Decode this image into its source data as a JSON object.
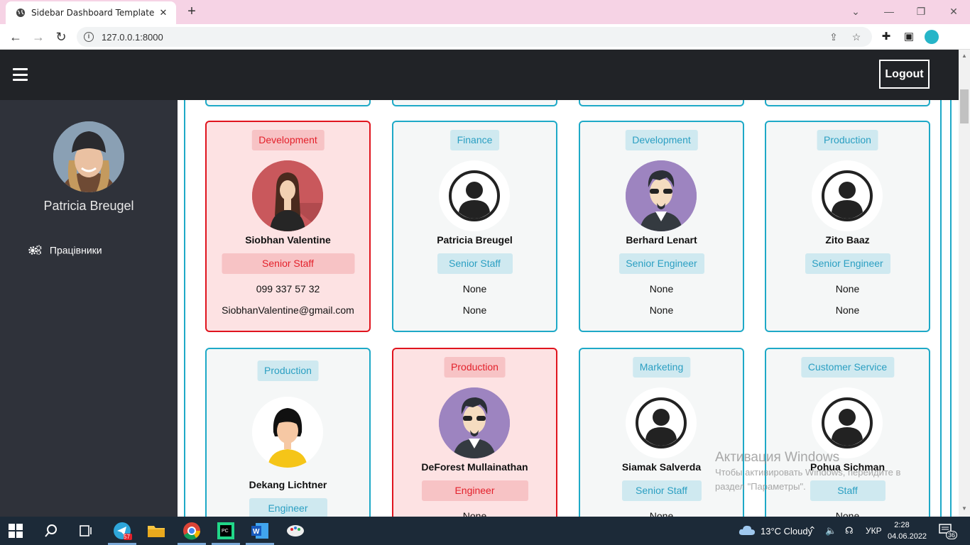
{
  "browser": {
    "tab_title": "Sidebar Dashboard Template",
    "url": "127.0.0.1:8000"
  },
  "header": {
    "logout_label": "Logout"
  },
  "sidebar": {
    "user_name": "Patricia Breugel",
    "items": [
      {
        "label": "Працівники",
        "icon": "gears-icon"
      }
    ]
  },
  "cards": [
    {
      "dept": "Development",
      "name": "Siobhan Valentine",
      "position": "Senior Staff",
      "phone": "099 337 57 32",
      "email": "SiobhanValentine@gmail.com",
      "avatar": "woman-dark-hair",
      "highlight": true
    },
    {
      "dept": "Finance",
      "name": "Patricia Breugel",
      "position": "Senior Staff",
      "phone": "None",
      "email": "None",
      "avatar": "default-user",
      "highlight": false
    },
    {
      "dept": "Development",
      "name": "Berhard Lenart",
      "position": "Senior Engineer",
      "phone": "None",
      "email": "None",
      "avatar": "man-sunglasses",
      "highlight": false
    },
    {
      "dept": "Production",
      "name": "Zito Baaz",
      "position": "Senior Engineer",
      "phone": "None",
      "email": "None",
      "avatar": "default-user",
      "highlight": false
    },
    {
      "dept": "Production",
      "name": "Dekang Lichtner",
      "position": "Engineer",
      "phone": "",
      "email": "",
      "avatar": "woman-yellow",
      "highlight": false
    },
    {
      "dept": "Production",
      "name": "DeForest Mullainathan",
      "position": "Engineer",
      "phone": "None",
      "email": "",
      "avatar": "man-sunglasses",
      "highlight": true
    },
    {
      "dept": "Marketing",
      "name": "Siamak Salverda",
      "position": "Senior Staff",
      "phone": "None",
      "email": "",
      "avatar": "default-user",
      "highlight": false
    },
    {
      "dept": "Customer Service",
      "name": "Pohua Sichman",
      "position": "Staff",
      "phone": "None",
      "email": "",
      "avatar": "default-user",
      "highlight": false
    }
  ],
  "watermark": {
    "title": "Активация Windows",
    "line1": "Чтобы активировать Windows, перейдите в",
    "line2": "раздел \"Параметры\"."
  },
  "taskbar": {
    "telegram_badge": "57",
    "weather": "13°C  Cloudy",
    "lang": "УКР",
    "time": "2:28",
    "date": "04.06.2022",
    "notifications": "36"
  },
  "colors": {
    "accent": "#1ea9c7",
    "highlight_border": "#e0141e",
    "highlight_bg": "#fde2e3",
    "header_bg": "#212327",
    "sidebar_bg": "#2f323a"
  }
}
